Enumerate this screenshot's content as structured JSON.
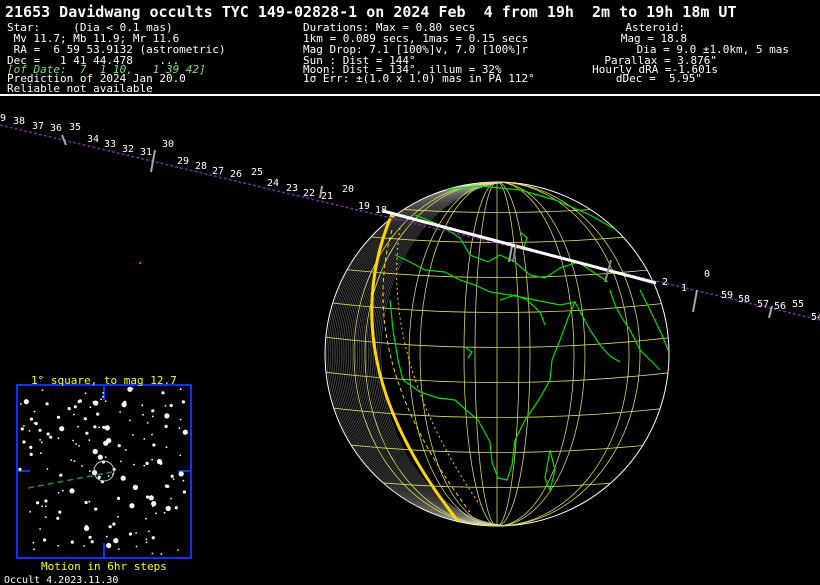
{
  "title": "21653 Davidwang occults TYC 149-02828-1 on 2024 Feb  4 from 19h  2m to 19h 18m UT",
  "star_info": [
    "Star:     (Dia < 0.1 mas)",
    " Mv 11.7; Mb 11.9; Mr 11.6",
    " RA =  6 59 53.9132 (astrometric)",
    "Dec =   1 41 44.478    ...",
    "[of Date:  7  1 10,   1 39 42]",
    "Prediction of 2024 Jan 20.0",
    "Reliable not available"
  ],
  "event_info": [
    "Durations: Max = 0.80 secs",
    "1km = 0.089 secs, 1mas = 0.15 secs",
    "Mag Drop: 7.1 [100%]v, 7.0 [100%]r",
    "Sun : Dist = 144°",
    "Moon: Dist = 134°, illum = 32%",
    "1σ Err: ±(1.0 x 1.0) mas in PA 112°"
  ],
  "asteroid_info": [
    "Asteroid:",
    "Mag = 18.8",
    "Dia = 9.0 ±1.0km, 5 mas",
    "Parallax = 3.876\"",
    "Hourly dRA =-1.601s",
    "dDec =  5.95\""
  ],
  "path_minute_labels": [
    "9",
    "38",
    "37",
    "36",
    "35",
    "34",
    "33",
    "32",
    "31",
    "30",
    "29",
    "28",
    "27",
    "26",
    "25",
    "24",
    "23",
    "22",
    "21",
    "20",
    "19",
    "18",
    "2",
    "1",
    "0",
    "59",
    "58",
    "57",
    "56",
    "55",
    "54"
  ],
  "star_chart": {
    "title": "1° square, to mag 12.7",
    "caption": "Motion in 6hr steps"
  },
  "footer": "Occult 4.2023.11.30",
  "colors": {
    "background": "#000000",
    "text": "#ffffff",
    "coastlines": "#00e000",
    "graticule": "#d8d860",
    "shadow_path": "#ffffff",
    "track": "#7030a0",
    "terminator": "#ffd700",
    "chart_border": "#1030ff",
    "chart_caption": "#ffff00"
  }
}
